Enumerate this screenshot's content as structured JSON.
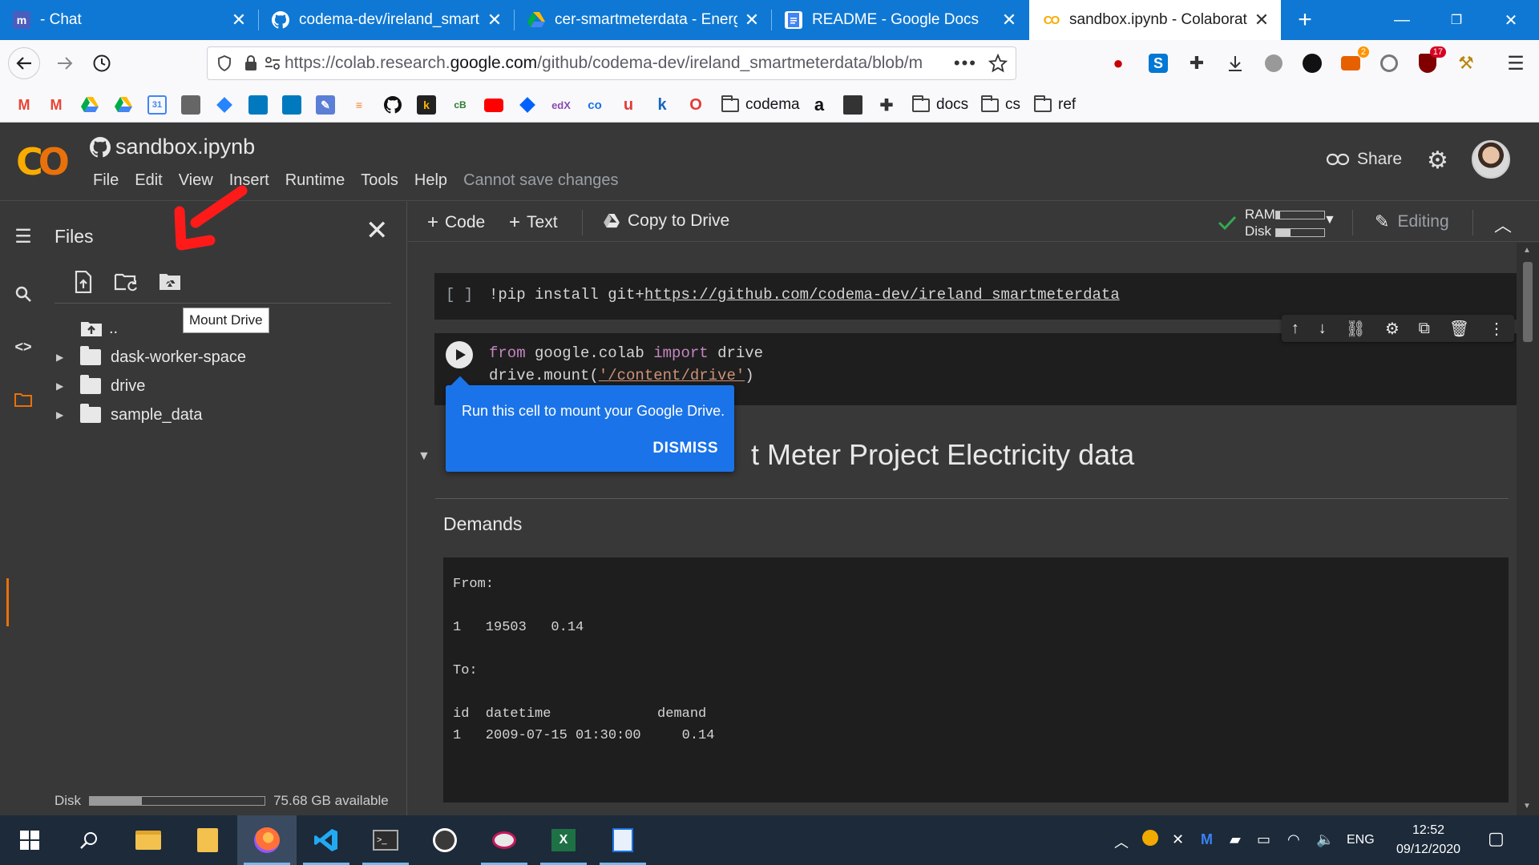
{
  "browser": {
    "tabs": [
      {
        "title": "- Chat",
        "favicon": "mattermost-icon",
        "active": false
      },
      {
        "title": "codema-dev/ireland_smartmeterdata",
        "favicon": "github-icon",
        "active": false
      },
      {
        "title": "cer-smartmeterdata - Energy",
        "favicon": "google-drive-icon",
        "active": false
      },
      {
        "title": "README - Google Docs",
        "favicon": "google-docs-icon",
        "active": false
      },
      {
        "title": "sandbox.ipynb - Colaboratory",
        "favicon": "colab-icon",
        "active": true
      }
    ],
    "url_prefix": "https://colab.research.",
    "url_domain": "google.com",
    "url_suffix": "/github/codema-dev/ireland_smartmeterdata/blob/m",
    "extension_badges": {
      "fire": "2",
      "ublock": "17"
    },
    "bookmark_folders": [
      "codema",
      "docs",
      "cs",
      "ref"
    ]
  },
  "colab": {
    "notebook_title": "sandbox.ipynb",
    "menu": [
      "File",
      "Edit",
      "View",
      "Insert",
      "Runtime",
      "Tools",
      "Help"
    ],
    "save_status": "Cannot save changes",
    "share_label": "Share",
    "toolbar": {
      "code_label": "Code",
      "text_label": "Text",
      "copy_to_drive_label": "Copy to Drive",
      "ram_label": "RAM",
      "disk_label": "Disk",
      "editing_label": "Editing"
    }
  },
  "files_panel": {
    "title": "Files",
    "tooltip": "Mount Drive",
    "parent_label": "..",
    "folders": [
      "dask-worker-space",
      "drive",
      "sample_data"
    ],
    "disk_label": "Disk",
    "disk_available": "75.68 GB available",
    "disk_used_fraction": 0.3
  },
  "notebook": {
    "cell1_prompt": "[ ]",
    "cell1_code_prefix": "!pip install git+",
    "cell1_code_link": "https://github.com/codema-dev/ireland_smartmeterdata",
    "cell2_line1": {
      "kw1": "from",
      "mid": " google.colab ",
      "kw2": "import",
      "end": " drive"
    },
    "cell2_line2": {
      "start": "drive.mount(",
      "str": "'/content/drive'",
      "end": ")"
    },
    "popup_text": "Run this cell to mount your Google Drive.",
    "popup_dismiss": "DISMISS",
    "heading": "t Meter Project Electricity data",
    "section": "Demands",
    "output": {
      "from_label": "From:",
      "from_row": "1   19503   0.14",
      "to_label": "To:",
      "header_row": "id  datetime             demand",
      "data_row": "1   2009-07-15 01:30:00     0.14"
    }
  },
  "taskbar": {
    "language": "ENG",
    "time": "12:52",
    "date": "09/12/2020"
  }
}
